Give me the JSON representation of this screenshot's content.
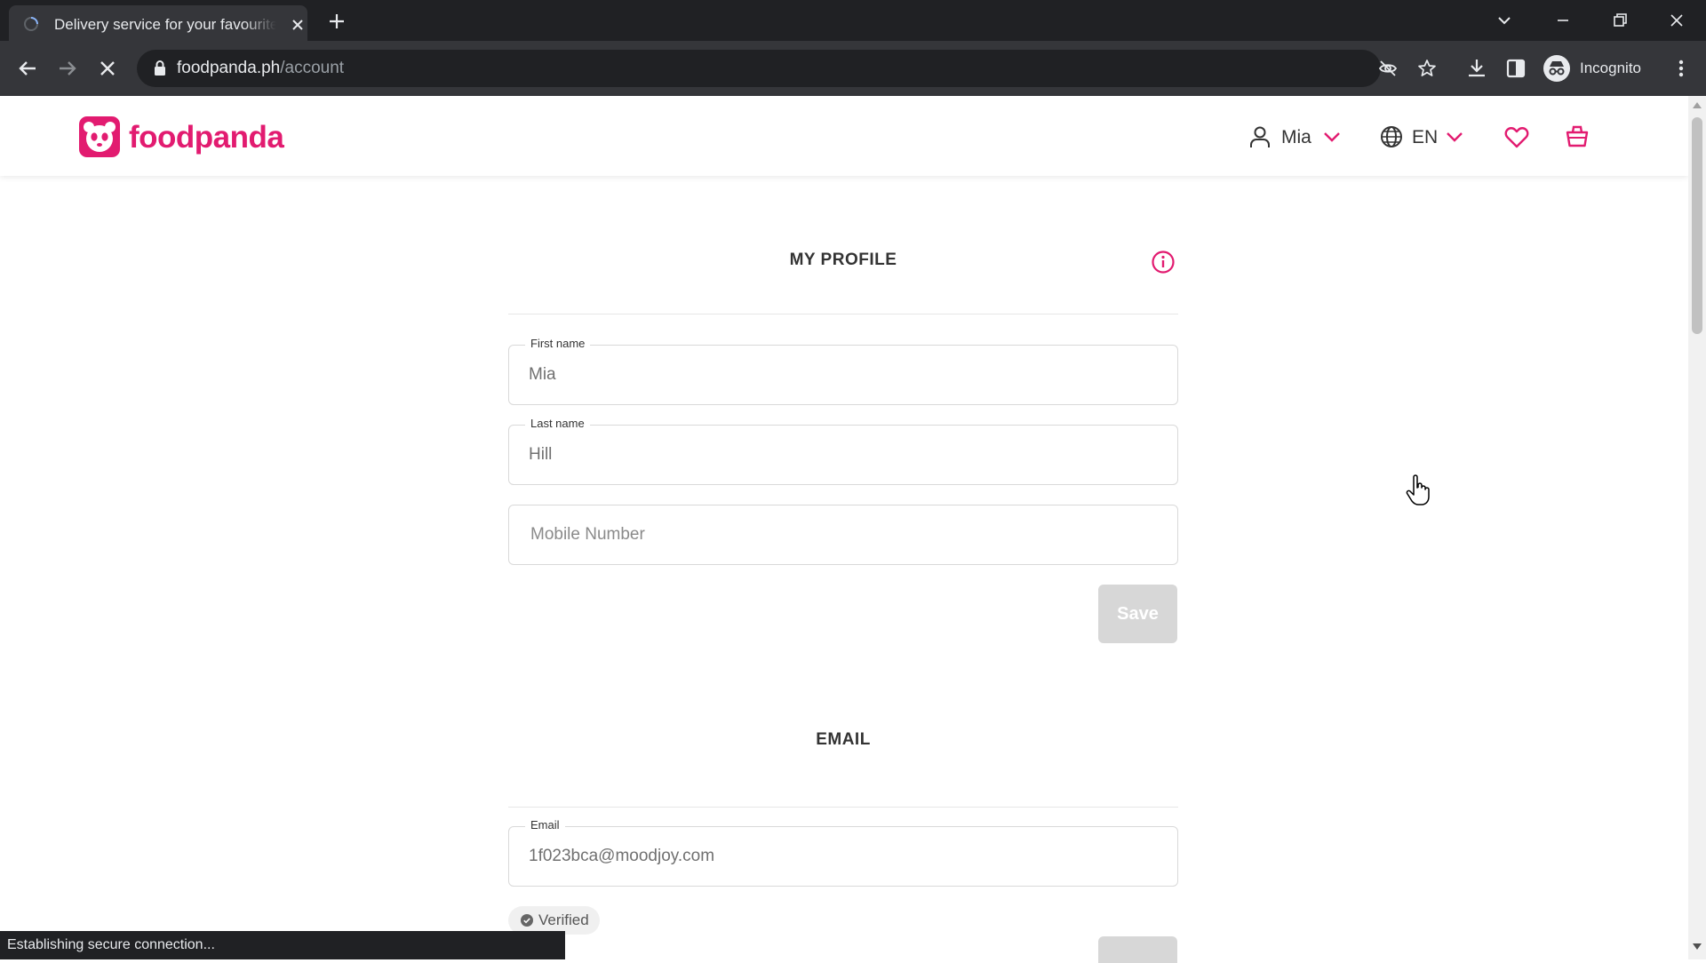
{
  "browser": {
    "tab_title": "Delivery service for your favourite food",
    "url_host": "foodpanda.ph",
    "url_path": "/account",
    "profile_label": "Incognito",
    "status_text": "Establishing secure connection..."
  },
  "header": {
    "brand": "foodpanda",
    "user_name": "Mia",
    "language": "EN"
  },
  "profile": {
    "title": "MY PROFILE",
    "first_name_label": "First name",
    "first_name_value": "Mia",
    "last_name_label": "Last name",
    "last_name_value": "Hill",
    "mobile_placeholder": "Mobile Number",
    "save_label": "Save"
  },
  "email": {
    "title": "EMAIL",
    "label": "Email",
    "value": "1f023bca@moodjoy.com",
    "status": "Verified"
  },
  "colors": {
    "brand_pink": "#e21b70",
    "chrome_dark": "#202124",
    "chrome_toolbar": "#35363a",
    "disabled_button": "#d7d7d7"
  },
  "icons": [
    "foodpanda-logo-icon",
    "user-icon",
    "globe-icon",
    "heart-icon",
    "basket-icon",
    "info-icon",
    "check-circle-icon"
  ]
}
